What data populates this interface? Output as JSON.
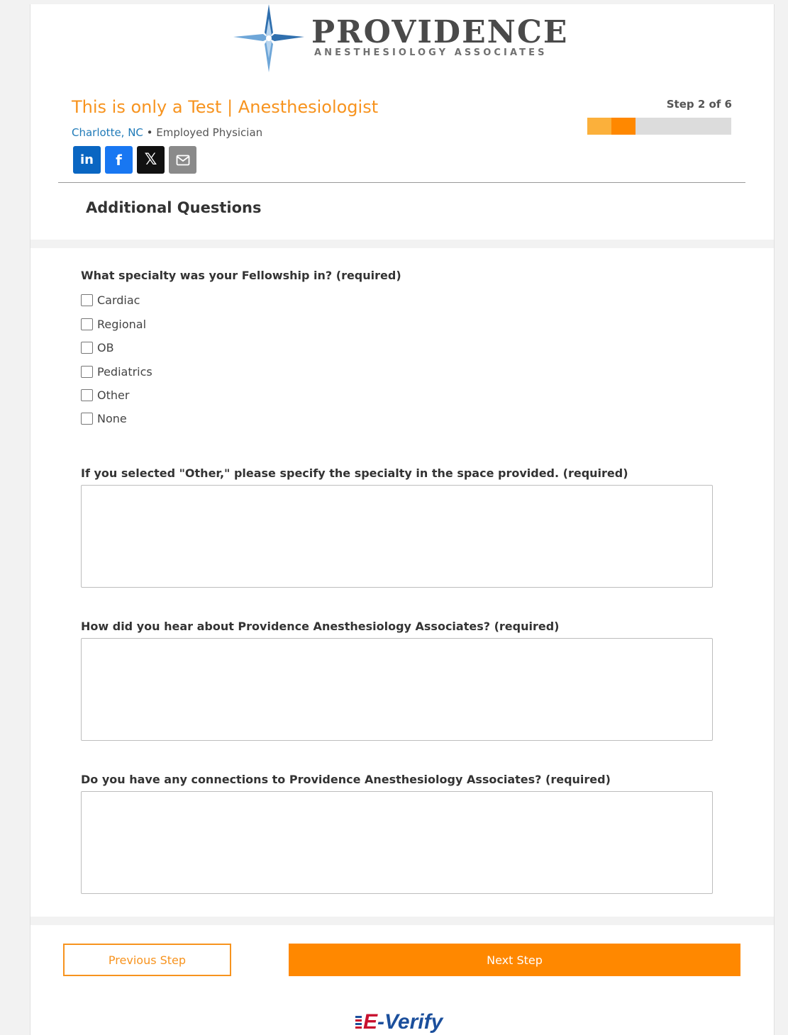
{
  "logo": {
    "name": "PROVIDENCE",
    "subtitle": "ANESTHESIOLOGY ASSOCIATES",
    "star_colors": [
      "#6ea6d8",
      "#2f6fae",
      "#b8d5ef"
    ]
  },
  "job": {
    "title": "This is only a Test | Anesthesiologist",
    "location": "Charlotte, NC",
    "separator": " • ",
    "employment_type": "Employed Physician"
  },
  "social": {
    "linkedin_label": "in",
    "facebook_label": "f",
    "x_label": "𝕏",
    "icons": [
      "linkedin-icon",
      "facebook-icon",
      "x-icon",
      "email-icon"
    ]
  },
  "progress": {
    "label": "Step 2 of 6",
    "current_step": 2,
    "total_steps": 6,
    "colors": {
      "done": "#fbb03b",
      "current": "#ff8800",
      "remaining": "#dcdcdc"
    }
  },
  "section": {
    "title": "Additional Questions"
  },
  "questions": {
    "fellowship": {
      "label": "What specialty was your Fellowship in? (required)",
      "options": [
        "Cardiac",
        "Regional",
        "OB",
        "Pediatrics",
        "Other",
        "None"
      ]
    },
    "other_specialty": {
      "label": "If you selected \"Other,\" please specify the specialty in the space provided. (required)",
      "value": ""
    },
    "hear_about": {
      "label": "How did you hear about Providence Anesthesiology Associates? (required)",
      "value": ""
    },
    "connections": {
      "label": "Do you have any connections to Providence Anesthesiology Associates? (required)",
      "value": ""
    }
  },
  "buttons": {
    "previous": "Previous Step",
    "next": "Next Step"
  },
  "footer": {
    "everify_e": "E",
    "everify_rest": "-Verify"
  },
  "colors": {
    "accent": "#f7931e",
    "button": "#ff8800",
    "link": "#1f7ab8"
  }
}
